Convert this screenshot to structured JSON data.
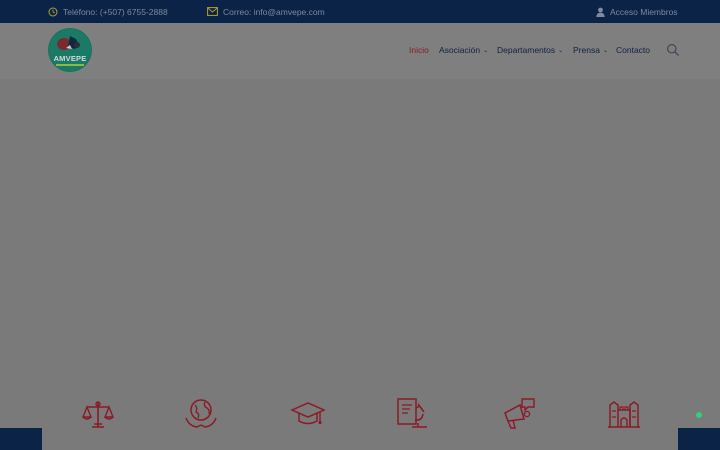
{
  "topbar": {
    "phone_text": "Teléfono: (+507) 6755-2888",
    "email_text": "Correo: info@amvepe.com",
    "login_text": "Acceso Miembros"
  },
  "header": {
    "logo_text": "AMVEPE"
  },
  "nav": {
    "items": [
      {
        "label": "Inicio",
        "active": true
      },
      {
        "label": "Asociación",
        "dropdown": true
      },
      {
        "label": "Departamentos",
        "dropdown": true
      },
      {
        "label": "Prensa",
        "dropdown": true
      },
      {
        "label": "Contacto"
      }
    ]
  },
  "services": {
    "icons": [
      "justice-scales-icon",
      "globe-hands-icon",
      "graduation-cap-icon",
      "research-microscope-icon",
      "megaphone-icon",
      "building-icon"
    ]
  },
  "colors": {
    "topbar_bg": "#0b2347",
    "accent_red": "#8a1a25",
    "nav_text": "#0f2142",
    "overlay_gray": "#7a7a7a"
  }
}
